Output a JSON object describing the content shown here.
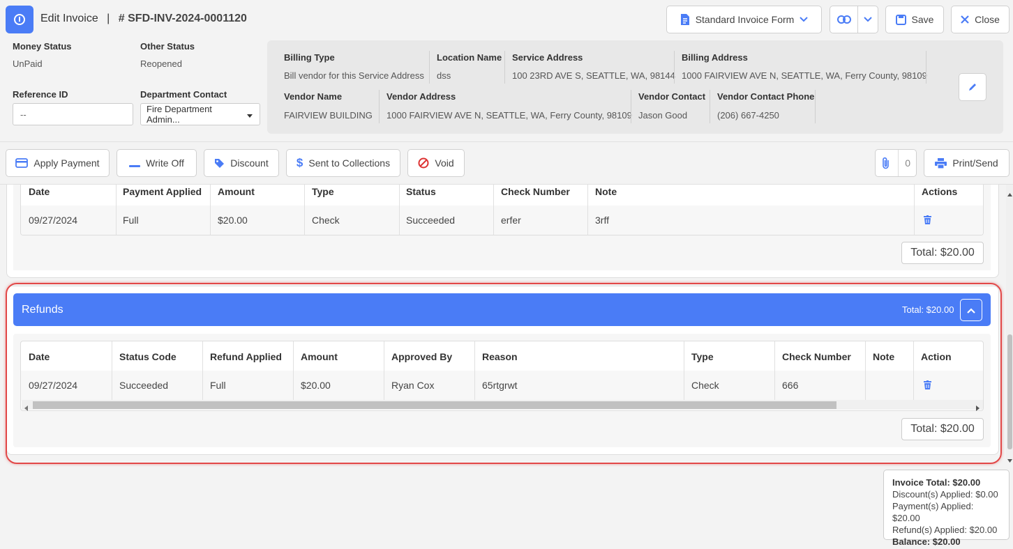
{
  "header": {
    "title": "Edit Invoice",
    "separator": "|",
    "invoice_number": "# SFD-INV-2024-0001120",
    "form_select": "Standard Invoice Form",
    "save_label": "Save",
    "close_label": "Close"
  },
  "status": {
    "money_status_label": "Money Status",
    "money_status_value": "UnPaid",
    "other_status_label": "Other Status",
    "other_status_value": "Reopened",
    "reference_label": "Reference ID",
    "reference_value": "--",
    "dept_contact_label": "Department Contact",
    "dept_contact_value": "Fire Department Admin..."
  },
  "info": {
    "billing_type_label": "Billing Type",
    "billing_type_value": "Bill vendor for this Service Address",
    "location_name_label": "Location Name",
    "location_name_value": "dss",
    "service_address_label": "Service Address",
    "service_address_value": "100 23RD AVE S, SEATTLE, WA, 98144",
    "billing_address_label": "Billing Address",
    "billing_address_value": "1000 FAIRVIEW AVE N, SEATTLE, WA, Ferry County, 98109",
    "vendor_name_label": "Vendor Name",
    "vendor_name_value": "FAIRVIEW BUILDING",
    "vendor_address_label": "Vendor Address",
    "vendor_address_value": "1000 FAIRVIEW AVE N, SEATTLE, WA, Ferry County, 98109",
    "vendor_contact_label": "Vendor Contact",
    "vendor_contact_value": "Jason Good",
    "vendor_phone_label": "Vendor Contact Phone",
    "vendor_phone_value": "(206) 667-4250"
  },
  "toolbar": {
    "apply_payment": "Apply Payment",
    "write_off": "Write Off",
    "discount": "Discount",
    "sent_to_collections": "Sent to Collections",
    "void": "Void",
    "attachments_count": "0",
    "print_send": "Print/Send"
  },
  "payments": {
    "headers": [
      "Date",
      "Payment Applied",
      "Amount",
      "Type",
      "Status",
      "Check Number",
      "Note",
      "Actions"
    ],
    "rows": [
      [
        "09/27/2024",
        "Full",
        "$20.00",
        "Check",
        "Succeeded",
        "erfer",
        "3rff"
      ]
    ],
    "total": "Total: $20.00"
  },
  "refunds": {
    "title": "Refunds",
    "header_total": "Total: $20.00",
    "headers": [
      "Date",
      "Status Code",
      "Refund Applied",
      "Amount",
      "Approved By",
      "Reason",
      "Type",
      "Check Number",
      "Note",
      "Action"
    ],
    "rows": [
      [
        "09/27/2024",
        "Succeeded",
        "Full",
        "$20.00",
        "Ryan Cox",
        "65rtgrwt",
        "Check",
        "666",
        ""
      ]
    ],
    "total": "Total: $20.00"
  },
  "summary": {
    "invoice_total": "Invoice Total: $20.00",
    "discounts": "Discount(s) Applied: $0.00",
    "payments": "Payment(s) Applied: $20.00",
    "refunds": "Refund(s) Applied: $20.00",
    "balance": "Balance: $20.00"
  },
  "colors": {
    "accent": "#4a7cf6",
    "highlight": "#e24848"
  }
}
